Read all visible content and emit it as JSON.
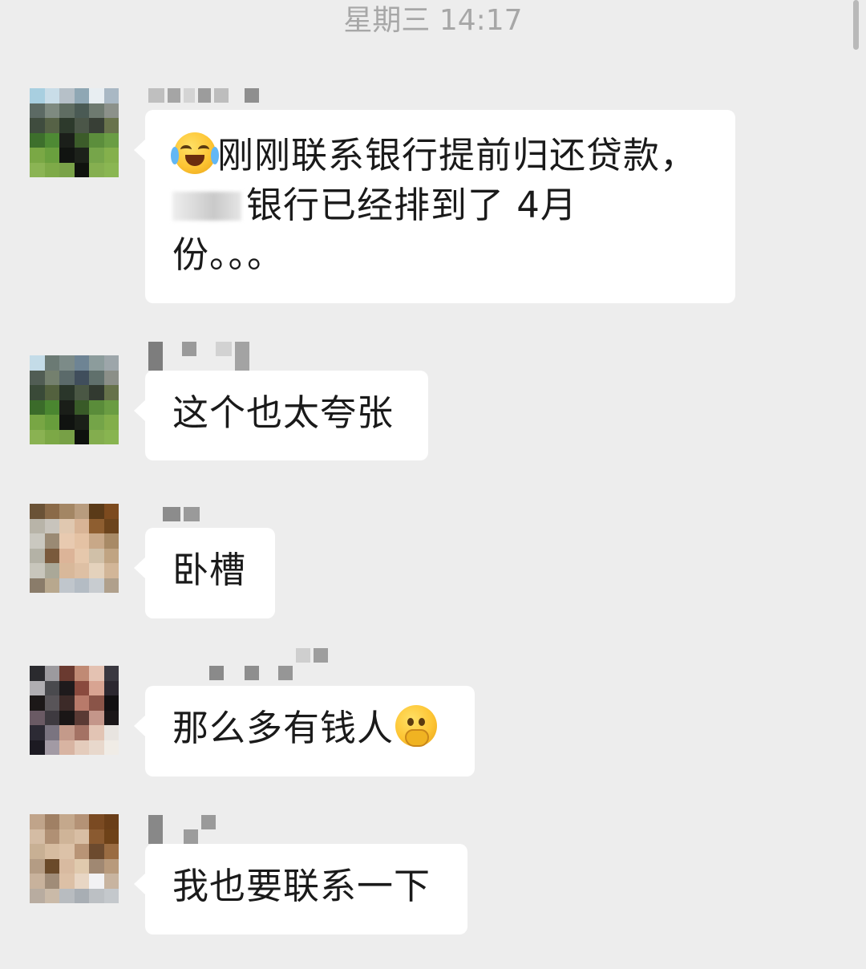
{
  "timestamp": "星期三 14:17",
  "messages": [
    {
      "id": "m1",
      "lines": [
        "刚刚联系银行提前归还贷款，",
        "银行已经排到了 4月",
        "份。。。"
      ],
      "emoji_start": "loudly-crying-face-icon"
    },
    {
      "id": "m2",
      "text": "这个也太夸张"
    },
    {
      "id": "m3",
      "text": "卧槽"
    },
    {
      "id": "m4",
      "text": "那么多有钱人",
      "emoji_end": "thinking-face-icon"
    },
    {
      "id": "m5",
      "text": "我也要联系一下"
    }
  ],
  "colors": {
    "background": "#ededed",
    "bubble": "#ffffff",
    "timestamp": "#a7a7a7",
    "text": "#1a1a1a"
  }
}
